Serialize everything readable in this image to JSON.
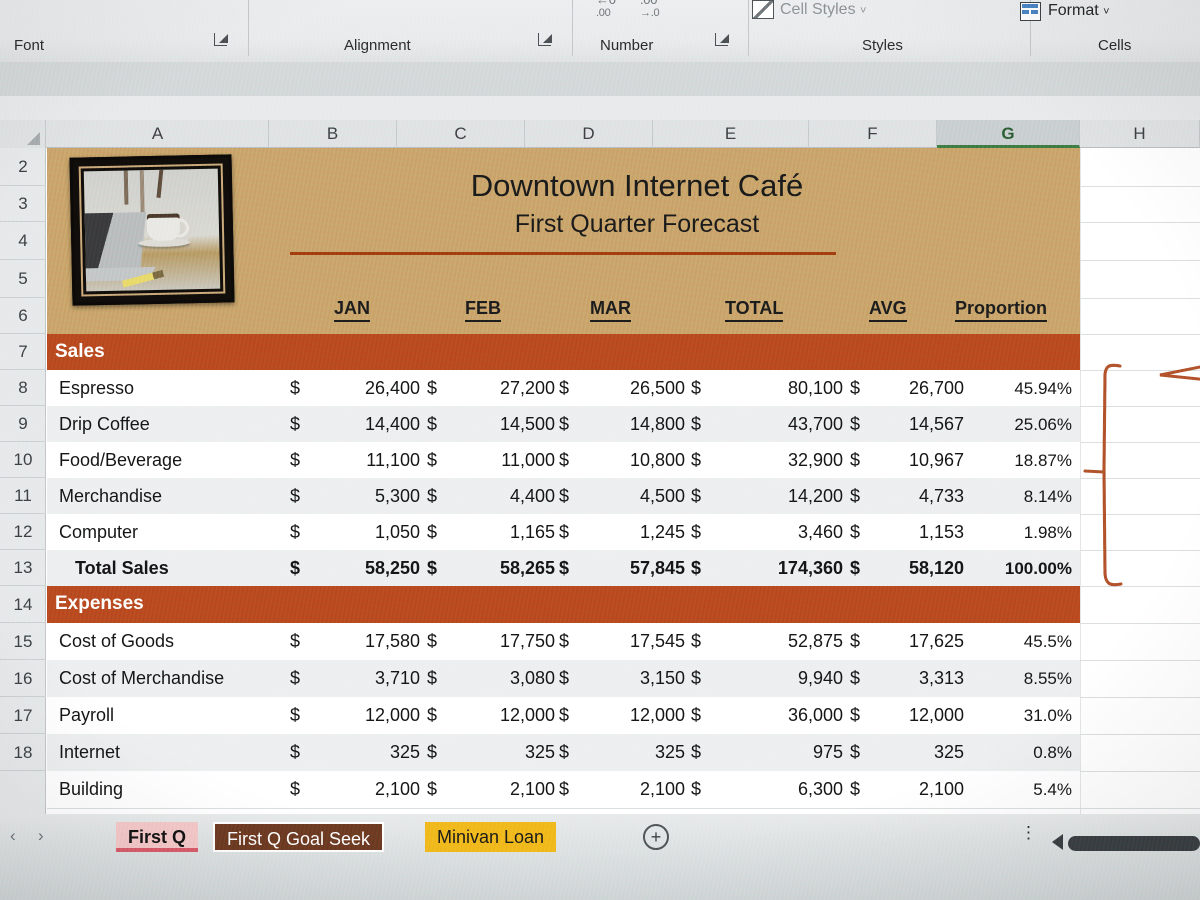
{
  "ribbon": {
    "groups": [
      {
        "label": "Font"
      },
      {
        "label": "Alignment"
      },
      {
        "label": "Number"
      },
      {
        "label": "Styles"
      },
      {
        "label": "Cells"
      }
    ],
    "commands": [
      {
        "label": "Cell Styles",
        "icon": "cell-styles-icon",
        "chevron": "˅"
      },
      {
        "label": "Format",
        "icon": "format-table-icon",
        "chevron": "˅"
      }
    ],
    "decrease_decimal_icon": ".00",
    "increase_decimal_icon": "→.0",
    "dialog_launcher_icon": "dialog-launcher"
  },
  "grid": {
    "column_headers": [
      "A",
      "B",
      "C",
      "D",
      "E",
      "F",
      "G",
      "H"
    ],
    "selected_column": "G",
    "row_headers": [
      "2",
      "3",
      "4",
      "5",
      "6",
      "7",
      "8",
      "9",
      "10",
      "11",
      "12",
      "13",
      "14",
      "15",
      "16",
      "17",
      "18"
    ]
  },
  "title_block": {
    "heading": "Downtown Internet Café",
    "subheading": "First Quarter Forecast",
    "picture_alt": "coffee-cup-and-laptop-photo"
  },
  "table": {
    "column_labels": [
      "JAN",
      "FEB",
      "MAR",
      "TOTAL",
      "AVG",
      "Proportion"
    ],
    "sections": [
      {
        "name": "Sales",
        "rows": [
          {
            "label": "Espresso",
            "jan": "26,400",
            "feb": "27,200",
            "mar": "26,500",
            "total": "80,100",
            "avg": "26,700",
            "pct": "45.94%",
            "bold": false
          },
          {
            "label": "Drip Coffee",
            "jan": "14,400",
            "feb": "14,500",
            "mar": "14,800",
            "total": "43,700",
            "avg": "14,567",
            "pct": "25.06%",
            "bold": false
          },
          {
            "label": "Food/Beverage",
            "jan": "11,100",
            "feb": "11,000",
            "mar": "10,800",
            "total": "32,900",
            "avg": "10,967",
            "pct": "18.87%",
            "bold": false
          },
          {
            "label": "Merchandise",
            "jan": "5,300",
            "feb": "4,400",
            "mar": "4,500",
            "total": "14,200",
            "avg": "4,733",
            "pct": "8.14%",
            "bold": false
          },
          {
            "label": "Computer",
            "jan": "1,050",
            "feb": "1,165",
            "mar": "1,245",
            "total": "3,460",
            "avg": "1,153",
            "pct": "1.98%",
            "bold": false
          },
          {
            "label": "Total Sales",
            "jan": "58,250",
            "feb": "58,265",
            "mar": "57,845",
            "total": "174,360",
            "avg": "58,120",
            "pct": "100.00%",
            "bold": true
          }
        ]
      },
      {
        "name": "Expenses",
        "rows": [
          {
            "label": "Cost of Goods",
            "jan": "17,580",
            "feb": "17,750",
            "mar": "17,545",
            "total": "52,875",
            "avg": "17,625",
            "pct": "45.5%",
            "bold": false
          },
          {
            "label": "Cost of Merchandise",
            "jan": "3,710",
            "feb": "3,080",
            "mar": "3,150",
            "total": "9,940",
            "avg": "3,313",
            "pct": "8.55%",
            "bold": false
          },
          {
            "label": "Payroll",
            "jan": "12,000",
            "feb": "12,000",
            "mar": "12,000",
            "total": "36,000",
            "avg": "12,000",
            "pct": "31.0%",
            "bold": false
          },
          {
            "label": "Internet",
            "jan": "325",
            "feb": "325",
            "mar": "325",
            "total": "975",
            "avg": "325",
            "pct": "0.8%",
            "bold": false
          },
          {
            "label": "Building",
            "jan": "2,100",
            "feb": "2,100",
            "mar": "2,100",
            "total": "6,300",
            "avg": "2,100",
            "pct": "5.4%",
            "bold": false
          }
        ]
      }
    ],
    "currency_symbol": "$"
  },
  "annotation": {
    "type": "hand-drawn-bracket-with-arrow",
    "color": "#b1512a"
  },
  "sheet_tabs": {
    "nav_prev_icon": "‹",
    "nav_next_icon": "›",
    "tabs": [
      {
        "label": "First Q",
        "state": "active"
      },
      {
        "label": "First Q Goal Seek",
        "state": "brown"
      },
      {
        "label": "Minivan Loan",
        "state": "gold"
      }
    ],
    "add_sheet_icon": "+",
    "options_icon": "⋮",
    "scroll_left_icon": "◀"
  },
  "colors": {
    "section_band": "#b8491f",
    "title_band": "#c9a46a",
    "selected_column": "#3e7a43",
    "active_tab": "#f5c8c8",
    "annotation": "#b1512a"
  }
}
